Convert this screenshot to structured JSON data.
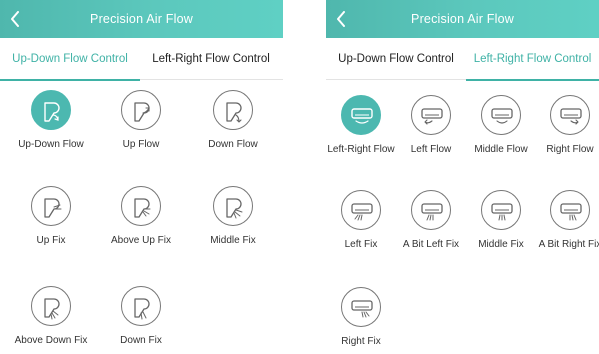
{
  "left_screen": {
    "header": {
      "title": "Precision Air Flow"
    },
    "tabs": [
      {
        "label": "Up-Down Flow Control",
        "active": true
      },
      {
        "label": "Left-Right Flow Control",
        "active": false
      }
    ],
    "options": [
      {
        "label": "Up-Down Flow",
        "icon": "up-down-flow-icon",
        "selected": true
      },
      {
        "label": "Up Flow",
        "icon": "up-flow-icon",
        "selected": false
      },
      {
        "label": "Down Flow",
        "icon": "down-flow-icon",
        "selected": false
      },
      {
        "label": "Up Fix",
        "icon": "up-fix-icon",
        "selected": false
      },
      {
        "label": "Above Up Fix",
        "icon": "above-up-fix-icon",
        "selected": false
      },
      {
        "label": "Middle Fix",
        "icon": "middle-fix-icon",
        "selected": false
      },
      {
        "label": "Above Down Fix",
        "icon": "above-down-fix-icon",
        "selected": false
      },
      {
        "label": "Down Fix",
        "icon": "down-fix-icon",
        "selected": false
      }
    ]
  },
  "right_screen": {
    "header": {
      "title": "Precision Air Flow"
    },
    "tabs": [
      {
        "label": "Up-Down Flow Control",
        "active": false
      },
      {
        "label": "Left-Right Flow Control",
        "active": true
      }
    ],
    "options": [
      {
        "label": "Left-Right Flow",
        "icon": "left-right-flow-icon",
        "selected": true
      },
      {
        "label": "Left Flow",
        "icon": "left-flow-icon",
        "selected": false
      },
      {
        "label": "Middle Flow",
        "icon": "middle-flow-icon",
        "selected": false
      },
      {
        "label": "Right Flow",
        "icon": "right-flow-icon",
        "selected": false
      },
      {
        "label": "Left Fix",
        "icon": "left-fix-icon",
        "selected": false
      },
      {
        "label": "A Bit Left Fix",
        "icon": "a-bit-left-fix-icon",
        "selected": false
      },
      {
        "label": "Middle Fix",
        "icon": "middle-fix-icon",
        "selected": false
      },
      {
        "label": "A Bit Right Fix",
        "icon": "a-bit-right-fix-icon",
        "selected": false
      },
      {
        "label": "Right Fix",
        "icon": "right-fix-icon",
        "selected": false
      }
    ]
  },
  "colors": {
    "accent": "#3fb2a6",
    "header_gradient_start": "#4fb7ad",
    "header_gradient_end": "#5fd0c4",
    "selected_fill": "#4cb8b0",
    "icon_stroke": "#777777"
  }
}
